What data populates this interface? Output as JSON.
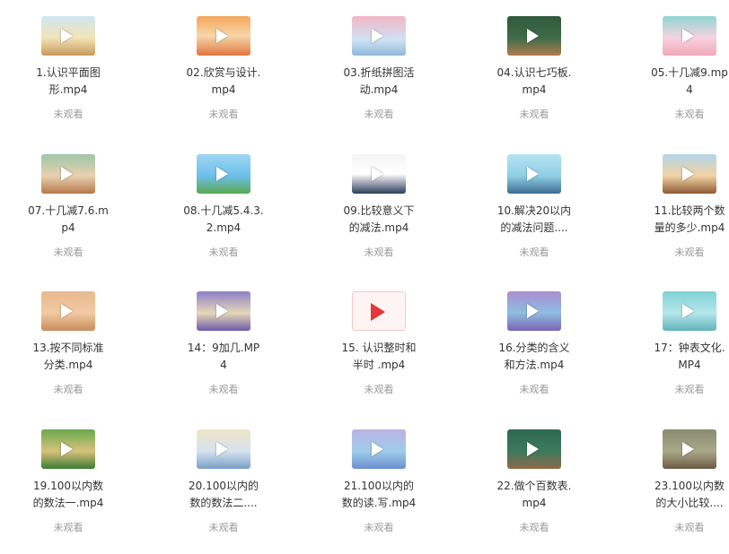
{
  "status_label": "未观看",
  "videos": [
    {
      "line1": "1.认识平面图",
      "line2": "形.mp4",
      "thumb": "scene-classroom-yellow",
      "status": "未观看"
    },
    {
      "line1": "02.欣赏与设计.",
      "line2": "mp4",
      "thumb": "scene-kids-orange",
      "status": "未观看"
    },
    {
      "line1": "03.折纸拼图活",
      "line2": "动.mp4",
      "thumb": "scene-pink-room",
      "status": "未观看"
    },
    {
      "line1": "04.认识七巧板.",
      "line2": "mp4",
      "thumb": "scene-chalkboard-green",
      "status": "未观看"
    },
    {
      "line1": "05.十几减9.mp",
      "line2": "4",
      "thumb": "scene-teal-room",
      "status": "未观看"
    },
    {
      "line1": "07.十几减7.6.m",
      "line2": "p4",
      "thumb": "scene-boy-green",
      "status": "未观看"
    },
    {
      "line1": "08.十几减5.4.3.",
      "line2": "2.mp4",
      "thumb": "scene-sky-blue",
      "status": "未观看"
    },
    {
      "line1": "09.比较意义下",
      "line2": "的减法.mp4",
      "thumb": "scene-board-white",
      "status": "未观看"
    },
    {
      "line1": "10.解决20以内",
      "line2": "的减法问题....",
      "thumb": "scene-teacher-blue",
      "status": "未观看"
    },
    {
      "line1": "11.比较两个数",
      "line2": "量的多少.mp4",
      "thumb": "scene-classroom-brown",
      "status": "未观看"
    },
    {
      "line1": "13.按不同标准",
      "line2": "分类.mp4",
      "thumb": "scene-boy-peach",
      "status": "未观看"
    },
    {
      "line1": "14：9加几.MP",
      "line2": "4",
      "thumb": "scene-purple-desk",
      "status": "未观看"
    },
    {
      "line1": "15. 认识整时和",
      "line2": "半时 .mp4",
      "thumb": "plain",
      "status": "未观看"
    },
    {
      "line1": "16.分类的含义",
      "line2": "和方法.mp4",
      "thumb": "scene-lion-purple",
      "status": "未观看"
    },
    {
      "line1": "17：钟表文化.",
      "line2": "MP4",
      "thumb": "scene-clock-teal",
      "status": "未观看"
    },
    {
      "line1": "19.100以内数",
      "line2": "的数法一.mp4",
      "thumb": "scene-forest-green",
      "status": "未观看"
    },
    {
      "line1": "20.100以内的",
      "line2": "数的数法二....",
      "thumb": "scene-door-cream",
      "status": "未观看"
    },
    {
      "line1": "21.100以内的",
      "line2": "数的读.写.mp4",
      "thumb": "scene-class-lavender",
      "status": "未观看"
    },
    {
      "line1": "22.做个百数表.",
      "line2": "mp4",
      "thumb": "scene-board-darkgreen",
      "status": "未观看"
    },
    {
      "line1": "23.100以内数",
      "line2": "的大小比较....",
      "thumb": "scene-outdoor-rock",
      "status": "未观看"
    }
  ],
  "colors": {
    "name_text": "#333333",
    "status_text": "#999999",
    "plain_play": "#e2373b"
  }
}
